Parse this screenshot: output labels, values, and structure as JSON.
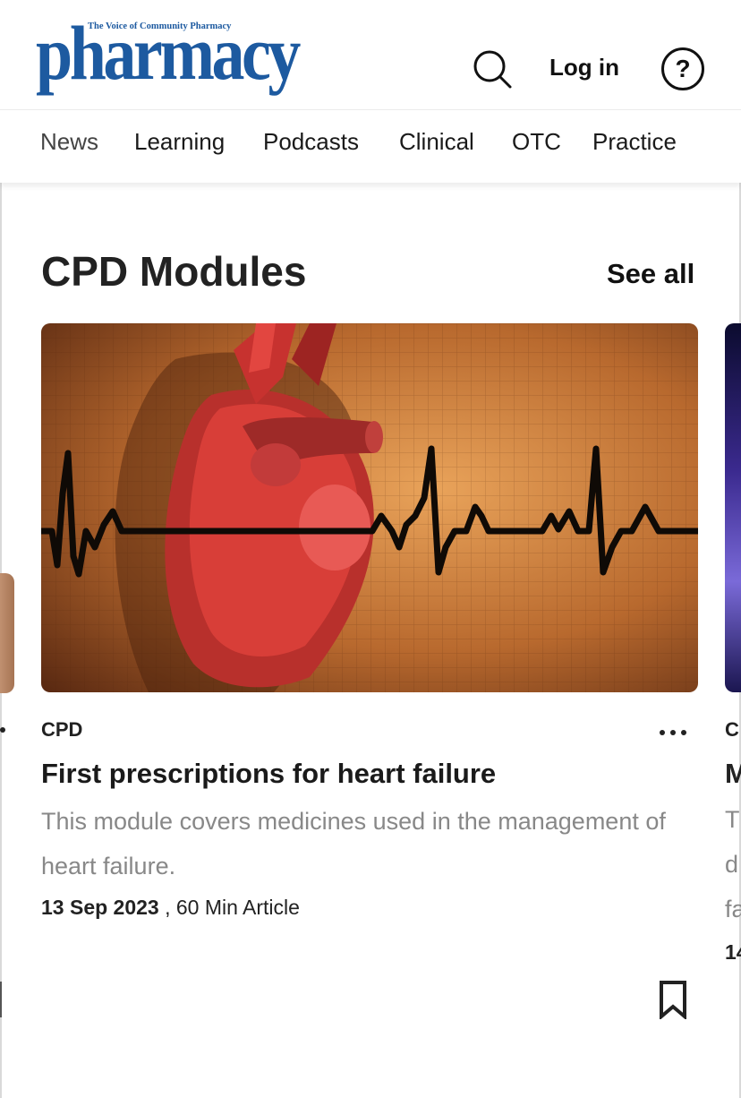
{
  "header": {
    "logo_tagline": "The Voice of Community Pharmacy",
    "logo_word": "pharmacy",
    "login_label": "Log in",
    "help_label": "?"
  },
  "nav": {
    "items": [
      {
        "label": "News",
        "active": true
      },
      {
        "label": "Learning",
        "active": false
      },
      {
        "label": "Podcasts",
        "active": false
      },
      {
        "label": "Clinical",
        "active": false
      },
      {
        "label": "OTC",
        "active": false
      },
      {
        "label": "Practice",
        "active": false
      }
    ]
  },
  "section": {
    "title": "CPD Modules",
    "see_all_label": "See all"
  },
  "card": {
    "category": "CPD",
    "more_label": "...",
    "title": "First prescriptions for heart failure",
    "description": "This module covers medicines used in the management of heart failure.",
    "date": "13 Sep 2023",
    "meta_suffix": " , 60 Min Article"
  },
  "peek_right": {
    "category_fragment": "C",
    "title_fragment": "M",
    "desc_fragments": [
      "T",
      "d",
      "fa"
    ],
    "meta_fragment": "14"
  },
  "colors": {
    "brand": "#1d5aa0",
    "text": "#1a1a1a",
    "muted": "#888888"
  },
  "icons": [
    "search-icon",
    "help-icon",
    "more-icon",
    "bookmark-icon"
  ]
}
